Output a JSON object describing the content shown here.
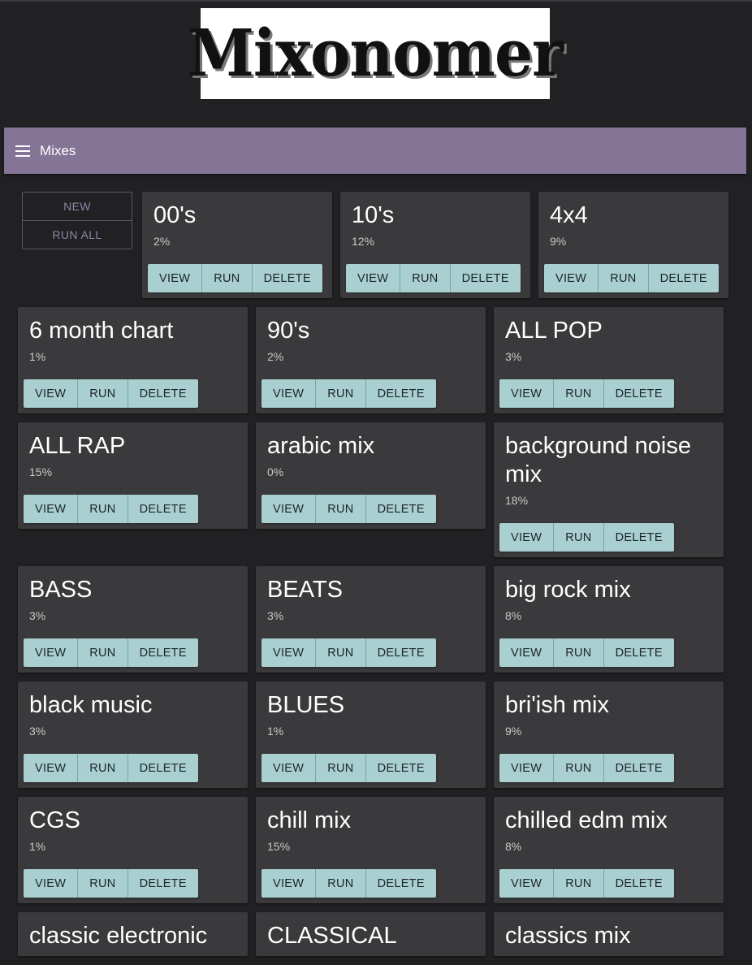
{
  "logo": {
    "text": "Mixonomer"
  },
  "appbar": {
    "title": "Mixes",
    "menu_icon": "menu-icon"
  },
  "controls": {
    "new_label": "NEW",
    "run_all_label": "RUN ALL"
  },
  "card_actions": {
    "view": "VIEW",
    "run": "RUN",
    "delete": "DELETE"
  },
  "rows": [
    [
      {
        "name": "00's",
        "pct": "2%"
      },
      {
        "name": "10's",
        "pct": "12%"
      },
      {
        "name": "4x4",
        "pct": "9%"
      }
    ],
    [
      {
        "name": "6 month chart",
        "pct": "1%"
      },
      {
        "name": "90's",
        "pct": "2%"
      },
      {
        "name": "ALL POP",
        "pct": "3%"
      }
    ],
    [
      {
        "name": "ALL RAP",
        "pct": "15%"
      },
      {
        "name": "arabic mix",
        "pct": "0%"
      },
      {
        "name": "background noise mix",
        "pct": "18%"
      }
    ],
    [
      {
        "name": "BASS",
        "pct": "3%"
      },
      {
        "name": "BEATS",
        "pct": "3%"
      },
      {
        "name": "big rock mix",
        "pct": "8%"
      }
    ],
    [
      {
        "name": "black music",
        "pct": "3%"
      },
      {
        "name": "BLUES",
        "pct": "1%"
      },
      {
        "name": "bri'ish mix",
        "pct": "9%"
      }
    ],
    [
      {
        "name": "CGS",
        "pct": "1%"
      },
      {
        "name": "chill mix",
        "pct": "15%"
      },
      {
        "name": "chilled edm mix",
        "pct": "8%"
      }
    ],
    [
      {
        "name": "classic electronic",
        "pct": ""
      },
      {
        "name": "CLASSICAL",
        "pct": ""
      },
      {
        "name": "classics mix",
        "pct": ""
      }
    ]
  ]
}
